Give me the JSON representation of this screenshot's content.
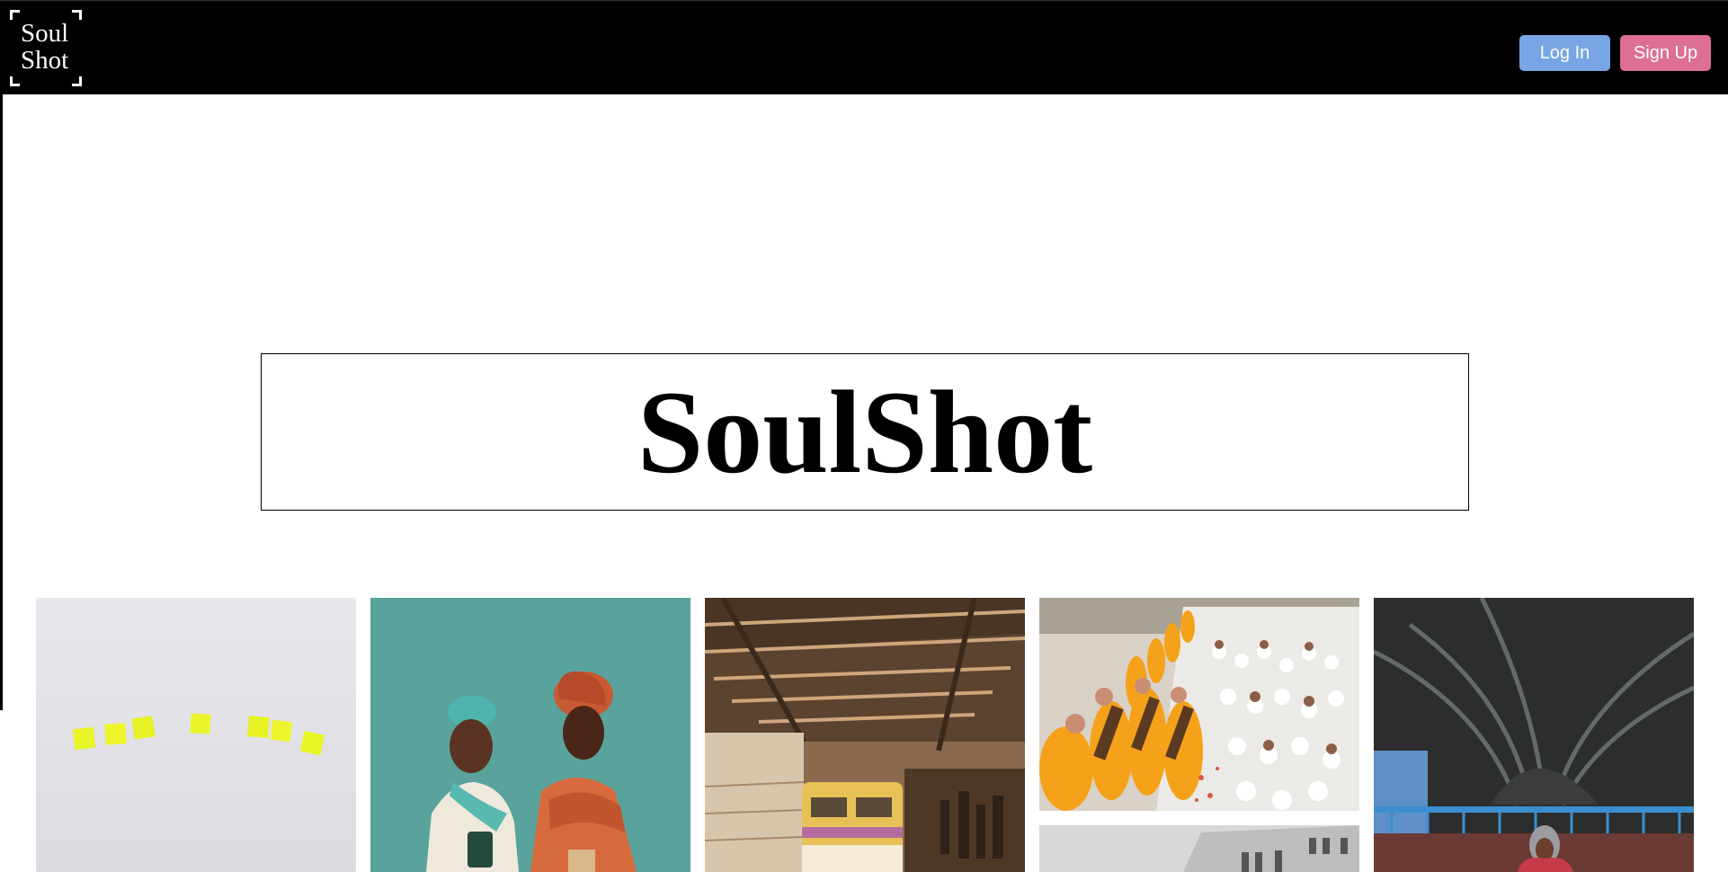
{
  "header": {
    "logo_line1": "Soul",
    "logo_line2": "Shot",
    "login_label": "Log In",
    "signup_label": "Sign Up"
  },
  "hero": {
    "title": "SoulShot"
  },
  "colors": {
    "header_bg": "#000000",
    "login_button": "#78a5e3",
    "signup_button": "#dd6e94"
  },
  "gallery": {
    "photos": [
      {
        "subject": "yellow sticky notes on white wall"
      },
      {
        "subject": "two women in headwraps on teal background"
      },
      {
        "subject": "train at station platform"
      },
      {
        "subject": "monks in orange robes with crowd"
      },
      {
        "subject": "grey building facade"
      },
      {
        "subject": "person under concrete overpass"
      }
    ]
  }
}
